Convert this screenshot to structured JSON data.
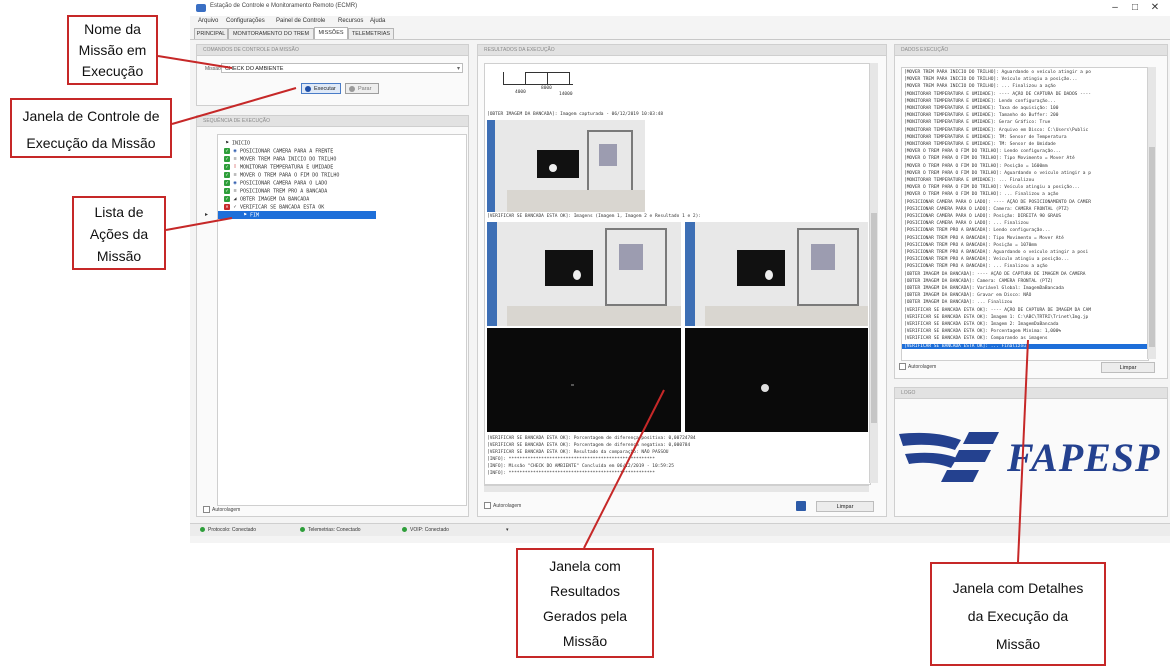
{
  "window": {
    "title": "Estação de Controle e Monitoramento Remoto (ECMR)",
    "minimize": "–",
    "maximize": "□",
    "close": "✕"
  },
  "menu": [
    "Arquivo",
    "Configurações",
    "Painel de Controle",
    "Recursos",
    "Ajuda"
  ],
  "tabs": [
    "PRINCIPAL",
    "MONITORAMENTO DO TREM",
    "MISSÕES",
    "TELEMETRIAS"
  ],
  "active_tab": "MISSÕES",
  "control": {
    "header": "COMANDOS DE CONTROLE DA MISSÃO",
    "mission_label": "Missão:",
    "mission_value": "CHECK DO AMBIENTE",
    "execute_label": "Executar",
    "stop_label": "Parar"
  },
  "actions": {
    "header": "SEQUÊNCIA DE EXECUÇÃO",
    "items": [
      {
        "label": "INICIO",
        "status": "none",
        "icon": "flag-icon"
      },
      {
        "label": "POSICIONAR CAMERA PARA A FRENTE",
        "status": "done",
        "icon": "camera-icon"
      },
      {
        "label": "MOVER TREM PARA INICIO DO TRILHO",
        "status": "done",
        "icon": "train-icon"
      },
      {
        "label": "MONITORAR TEMPERATURA E UMIDADE",
        "status": "done",
        "icon": "thermometer-icon"
      },
      {
        "label": "MOVER O TREM PARA O FIM DO TRILHO",
        "status": "done",
        "icon": "train-icon"
      },
      {
        "label": "POSICIONAR CAMERA PARA O LADO",
        "status": "done",
        "icon": "camera-icon"
      },
      {
        "label": "POSICIONAR TREM PRO A BANCADA",
        "status": "done",
        "icon": "train-icon"
      },
      {
        "label": "OBTER IMAGEM DA BANCADA",
        "status": "done",
        "icon": "image-icon"
      },
      {
        "label": "VERIFICAR SE BANCADA ESTA OK",
        "status": "error",
        "icon": "check-icon"
      },
      {
        "label": "FIM",
        "status": "current",
        "icon": "flag-icon"
      }
    ],
    "autoscroll_label": "Autorolagem"
  },
  "results": {
    "header": "RESULTADOS DA EXECUÇÃO",
    "scale_ticks": [
      "4000",
      "8000",
      "14000"
    ],
    "lines_top": [
      "[OBTER IMAGEM DA BANCADA]: Imagem capturada - 06/12/2019 10:03:48"
    ],
    "lines_mid": [
      "[VERIFICAR SE BANCADA ESTA OK]: Imagens (Imagem 1, Imagem 2 e Resultado 1 e 2):"
    ],
    "lines_bottom": [
      "[VERIFICAR SE BANCADA ESTA OK]: Porcentagem de diferença positiva: 0,00724784",
      "[VERIFICAR SE BANCADA ESTA OK]: Porcentagem de diferença negativa: 0,000784",
      "[VERIFICAR SE BANCADA ESTA OK]: Resultado da comparação: NÃO PASSOU",
      "[INFO]: ******************************************************",
      "[INFO]: Missão \"CHECK DO AMBIENTE\" Concluída em 06/12/2019 - 10:59:25",
      "[INFO]: ******************************************************"
    ],
    "autoscroll_label": "Autorolagem",
    "clear_label": "Limpar"
  },
  "details": {
    "header": "DADOS EXECUÇÃO",
    "lines": [
      "[MOVER TREM PARA INICIO DO TRILHO]: Aguardando o veículo atingir a po",
      "[MOVER TREM PARA INICIO DO TRILHO]: Veículo atingiu a posição...",
      "[MOVER TREM PARA INICIO DO TRILHO]: ... Finalizou a ação",
      "[MONITORAR TEMPERATURA E UMIDADE]: ---- AÇÃO DE CAPTURA DE DADOS ----",
      "[MONITORAR TEMPERATURA E UMIDADE]: Lendo configuração...",
      "[MONITORAR TEMPERATURA E UMIDADE]: Taxa de aquisição: 100",
      "[MONITORAR TEMPERATURA E UMIDADE]: Tamanho do Buffer: 200",
      "[MONITORAR TEMPERATURA E UMIDADE]: Gerar Gráfico: True",
      "[MONITORAR TEMPERATURA E UMIDADE]: Arquivo em Disco: C:\\Users\\Public",
      "[MONITORAR TEMPERATURA E UMIDADE]: TM: Sensor de Temperatura",
      "[MONITORAR TEMPERATURA E UMIDADE]: TM: Sensor de Umidade",
      "[MOVER O TREM PARA O FIM DO TRILHO]: Lendo configuração...",
      "[MOVER O TREM PARA O FIM DO TRILHO]: Tipo Movimento = Mover Até",
      "[MOVER O TREM PARA O FIM DO TRILHO]: Posição = 1600mm",
      "[MOVER O TREM PARA O FIM DO TRILHO]: Aguardando o veículo atingir a p",
      "[MONITORAR TEMPERATURA E UMIDADE]: ... Finalizou",
      "[MOVER O TREM PARA O FIM DO TRILHO]: Veículo atingiu a posição...",
      "[MOVER O TREM PARA O FIM DO TRILHO]: ... Finalizou a ação",
      "[POSICIONAR CAMERA PARA O LADO]: ---- AÇÃO DE POSICIONAMENTO DA CAMER",
      "[POSICIONAR CAMERA PARA O LADO]: Camera: CAMERA FRONTAL (PTZ)",
      "[POSICIONAR CAMERA PARA O LADO]: Posição: DIREITA 90 GRAUS",
      "[POSICIONAR CAMERA PARA O LADO]: ... Finalizou",
      "[POSICIONAR TREM PRO A BANCADA]: Lendo configuração...",
      "[POSICIONAR TREM PRO A BANCADA]: Tipo Movimento = Mover Até",
      "[POSICIONAR TREM PRO A BANCADA]: Posição = 1070mm",
      "[POSICIONAR TREM PRO A BANCADA]: Aguardando o veículo atingir a posi",
      "[POSICIONAR TREM PRO A BANCADA]: Veículo atingiu a posição...",
      "[POSICIONAR TREM PRO A BANCADA]: ... Finalizou a ação",
      "[OBTER IMAGEM DA BANCADA]: ---- AÇÃO DE CAPTURA DE IMAGEM DA CAMERA",
      "[OBTER IMAGEM DA BANCADA]: Camera: CAMERA FRONTAL (PTZ)",
      "[OBTER IMAGEM DA BANCADA]: Variável Global: ImagemDaBancada",
      "[OBTER IMAGEM DA BANCADA]: Gravar em Disco: NÃO",
      "[OBTER IMAGEM DA BANCADA]: ... Finalizou",
      "[VERIFICAR SE BANCADA ESTA OK]: ---- AÇÃO DE CAPTURA DE IMAGEM DA CAM",
      "[VERIFICAR SE BANCADA ESTA OK]: Imagem 1: C:\\ABC\\TRTRI\\Trinet\\Img.jp",
      "[VERIFICAR SE BANCADA ESTA OK]: Imagem 2: ImagemDaBancada",
      "[VERIFICAR SE BANCADA ESTA OK]: Porcentagem Mínima: 1,000%",
      "[VERIFICAR SE BANCADA ESTA OK]: Comparando as imagens",
      "[VERIFICAR SE BANCADA ESTA OK]: ... Finalizou"
    ],
    "autoscroll_label": "Autorolagem",
    "clear_label": "Limpar"
  },
  "logo": {
    "header": "LOGO",
    "text": "FAPESP"
  },
  "status": [
    {
      "label": "Protocolo: Conectado"
    },
    {
      "label": "Telemetrias: Conectado"
    },
    {
      "label": "VOIP: Conectado"
    }
  ],
  "callouts": {
    "nome": [
      "Nome da",
      "Missão em",
      "Execução"
    ],
    "controle": [
      "Janela de Controle de",
      "Execução da Missão"
    ],
    "lista": [
      "Lista de",
      "Ações da",
      "Missão"
    ],
    "resultados": [
      "Janela com",
      "Resultados",
      "Gerados pela",
      "Missão"
    ],
    "detalhes": [
      "Janela com Detalhes",
      "da Execução da",
      "Missão"
    ]
  },
  "colors": {
    "annotation_red": "#c62828",
    "selection_blue": "#1e6fd9",
    "status_green": "#2e9e3a",
    "logo_blue": "#24418f"
  }
}
